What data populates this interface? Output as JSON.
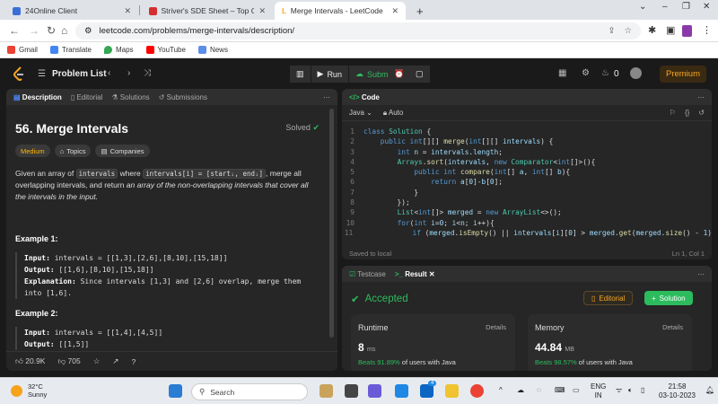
{
  "browser": {
    "tabs": [
      {
        "title": "24Online Client",
        "active": false
      },
      {
        "title": "Striver's SDE Sheet – Top Coding",
        "active": false
      },
      {
        "title": "Merge Intervals - LeetCode",
        "active": true
      }
    ],
    "new_tab": "+",
    "window_controls": [
      "⌄",
      "–",
      "❐",
      "✕"
    ],
    "url": "leetcode.com/problems/merge-intervals/description/",
    "bookmarks": [
      "Gmail",
      "Translate",
      "Maps",
      "YouTube",
      "News"
    ]
  },
  "lc_nav": {
    "problem_list": "Problem List",
    "run": "Run",
    "submit": "Submit",
    "streak": "0",
    "premium": "Premium"
  },
  "desc_panel": {
    "tabs": [
      "Description",
      "Editorial",
      "Solutions",
      "Submissions"
    ],
    "title": "56. Merge Intervals",
    "solved": "Solved",
    "difficulty": "Medium",
    "chip_topics": "Topics",
    "chip_companies": "Companies",
    "para": {
      "p1": "Given an array of ",
      "c1": "intervals",
      "p2": " where ",
      "c2": "intervals[i] = [startᵢ, endᵢ]",
      "p3": ", merge all overlapping intervals, and return ",
      "p4": "an array of the non-overlapping intervals that cover all the intervals in the input."
    },
    "example1": {
      "title": "Example 1:",
      "input_label": "Input:",
      "input": " intervals = [[1,3],[2,6],[8,10],[15,18]]",
      "output_label": "Output:",
      "output": " [[1,6],[8,10],[15,18]]",
      "expl_label": "Explanation:",
      "expl": " Since intervals [1,3] and [2,6] overlap, merge them into [1,6]."
    },
    "example2": {
      "title": "Example 2:",
      "input_label": "Input:",
      "input": " intervals = [[1,4],[4,5]]",
      "output_label": "Output:",
      "output": " [[1,5]]"
    },
    "likes": "20.9K",
    "dislikes": "705"
  },
  "code_panel": {
    "title": "Code",
    "language": "Java",
    "auto": "Auto",
    "status": "Saved to local",
    "cursor": "Ln 1, Col 1",
    "lines": [
      "class Solution {",
      "    public int[][] merge(int[][] intervals) {",
      "        int n = intervals.length;",
      "        Arrays.sort(intervals, new Comparator<int[]>(){",
      "            public int compare(int[] a, int[] b){",
      "                return a[0]-b[0];",
      "            }",
      "        });",
      "        List<int[]> merged = new ArrayList<>();",
      "        for(int i=0; i<n; i++){",
      "            if (merged.isEmpty() || intervals[i][0] > merged.get(merged.size() - 1)"
    ]
  },
  "result_panel": {
    "tab_testcase": "Testcase",
    "tab_result": "Result",
    "status": "Accepted",
    "editorial": "Editorial",
    "solution": "Solution",
    "runtime": {
      "label": "Runtime",
      "details": "Details",
      "value": "8",
      "unit": "ms",
      "beats": "Beats 91.89%",
      "suffix": " of users with Java"
    },
    "memory": {
      "label": "Memory",
      "details": "Details",
      "value": "44.84",
      "unit": "MB",
      "beats": "Beats 98.57%",
      "suffix": " of users with Java"
    }
  },
  "taskbar": {
    "temp": "32°C",
    "weather": "Sunny",
    "search": "Search",
    "lang1": "ENG",
    "lang2": "IN",
    "time": "21:58",
    "date": "03-10-2023",
    "badge": "4"
  },
  "colors": {
    "accent_green": "#2cbb5d",
    "premium_orange": "#f5a623",
    "medium_yellow": "#ffb800"
  }
}
